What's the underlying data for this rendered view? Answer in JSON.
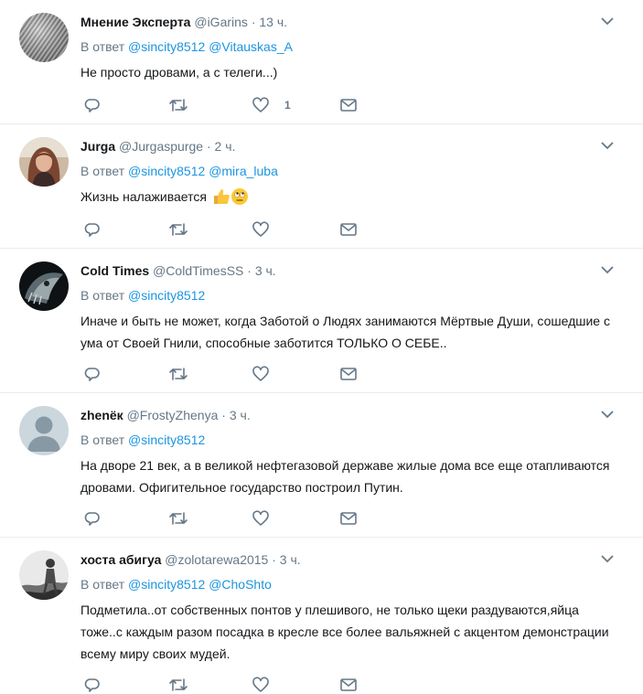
{
  "tweets": [
    {
      "name": "Мнение Эксперта",
      "handle": "@iGarins",
      "dot": "·",
      "time": "13 ч.",
      "reply_prefix": "В ответ",
      "mentions": [
        "@sincity8512",
        "@Vitauskas_A"
      ],
      "text": "Не просто дровами, а с телеги...)",
      "like_count": "1",
      "avatar": "gray-circle-pattern"
    },
    {
      "name": "Jurga",
      "handle": "@Jurgaspurge",
      "dot": "·",
      "time": "2 ч.",
      "reply_prefix": "В ответ",
      "mentions": [
        "@sincity8512",
        "@mira_luba"
      ],
      "text": "Жизнь налаживается",
      "emoji": [
        "thumbs-up",
        "face-with-rolling-eyes"
      ],
      "avatar": "woman-photo"
    },
    {
      "name": "Cold Times",
      "handle": "@ColdTimesSS",
      "dot": "·",
      "time": "3 ч.",
      "reply_prefix": "В ответ",
      "mentions": [
        "@sincity8512"
      ],
      "text": "Иначе и быть не может, когда Заботой о Людях занимаются Мёртвые Души, сошедшие с ума от Своей Гнили, способные заботится ТОЛЬКО О СЕБЕ..",
      "avatar": "dark-creature"
    },
    {
      "name": "zhenёк",
      "handle": "@FrostyZhenya",
      "dot": "·",
      "time": "3 ч.",
      "reply_prefix": "В ответ",
      "mentions": [
        "@sincity8512"
      ],
      "text": "На дворе 21 век, а в великой нефтегазовой державе жилые дома все еще отапливаются дровами. Офигительное государство построил Путин.",
      "avatar": "default-profile"
    },
    {
      "name": "хоста абигуа",
      "handle": "@zolotarewa2015",
      "dot": "·",
      "time": "3 ч.",
      "reply_prefix": "В ответ",
      "mentions": [
        "@sincity8512",
        "@ChoShto"
      ],
      "text": "Подметила..от собственных понтов у плешивого, не только щеки раздуваются,яйца тоже..с каждым разом посадка в кресле все более вальяжней с акцентом демонстрации всему миру своих мудей.",
      "avatar": "bw-figure"
    }
  ],
  "colors": {
    "link": "#1b95e0",
    "muted": "#657786",
    "text": "#14171a",
    "divider": "#e6ecf0"
  }
}
